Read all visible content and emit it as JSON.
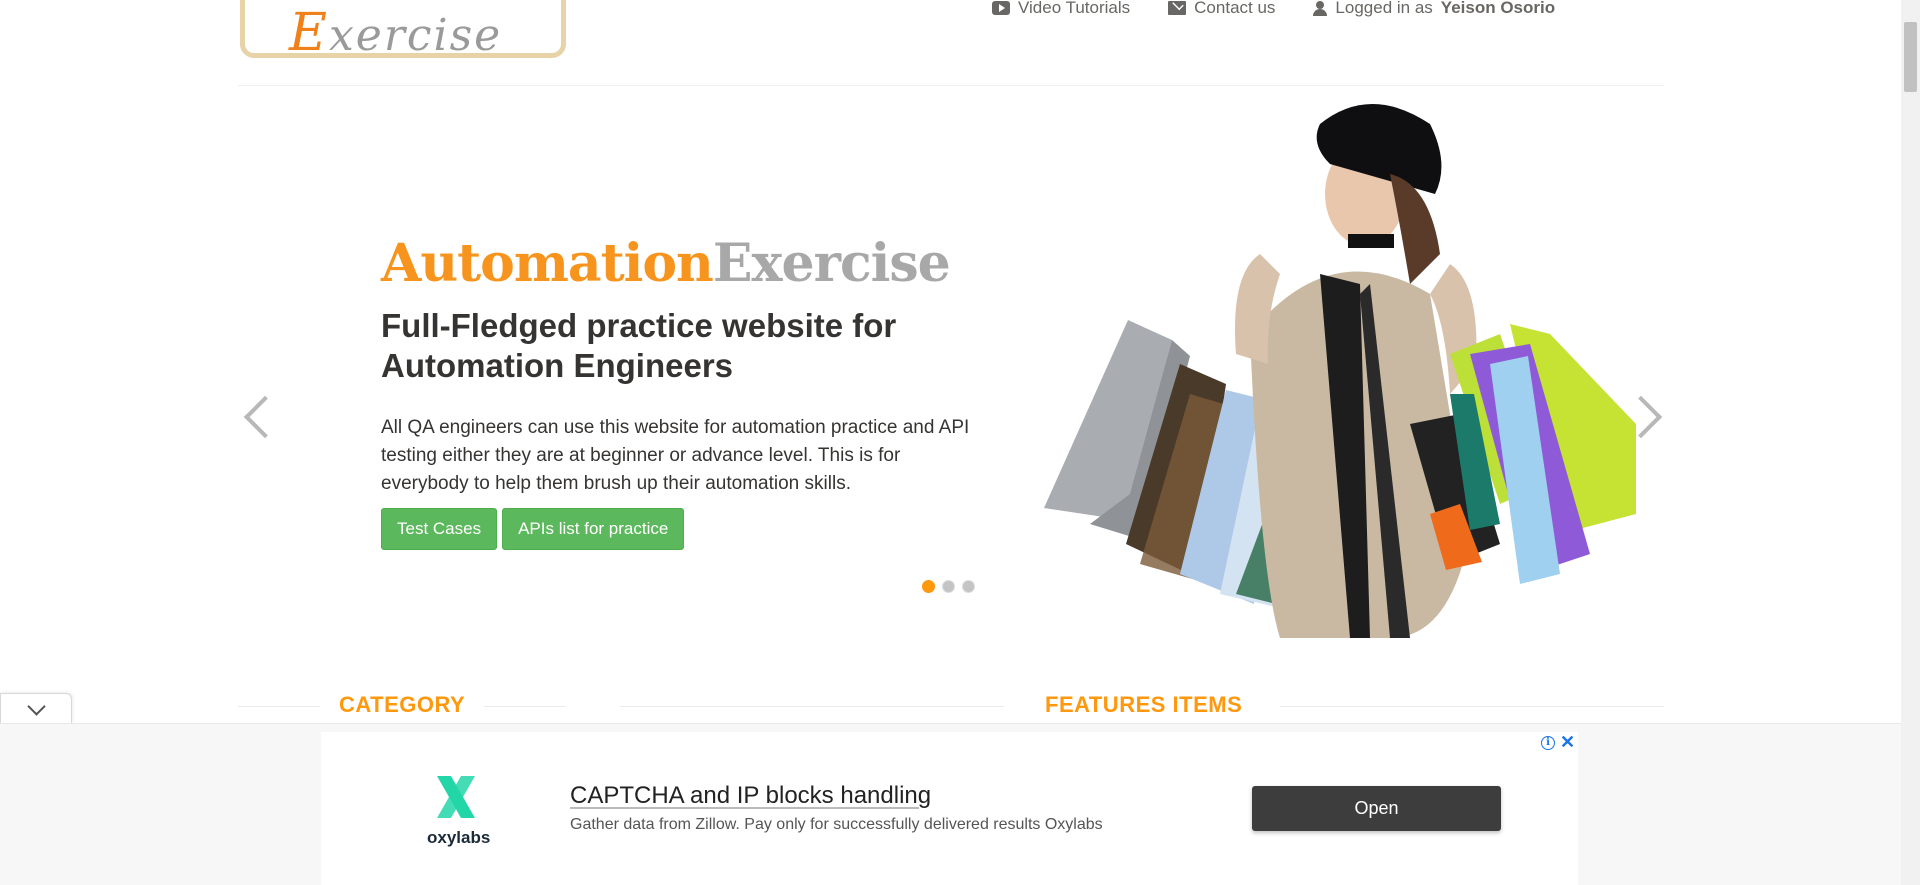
{
  "logo": {
    "text_first": "E",
    "text_rest": "xercise"
  },
  "nav": {
    "video_tutorials": "Video Tutorials",
    "contact_us": "Contact us",
    "logged_in_prefix": "Logged in as",
    "username": "Yeison Osorio"
  },
  "slider": {
    "brand_part1": "Automation",
    "brand_part2": "Exercise",
    "title_line1": "Full-Fledged practice website for",
    "title_line2": "Automation Engineers",
    "description": "All QA engineers can use this website for automation practice and API testing either they are at beginner or advance level. This is for everybody to help them brush up their automation skills.",
    "buttons": {
      "test_cases": "Test Cases",
      "apis_list": "APIs list for practice"
    },
    "active_slide": 1,
    "slide_count": 3
  },
  "sections": {
    "category": "CATEGORY",
    "features": "FEATURES ITEMS"
  },
  "ad": {
    "brand": "oxylabs",
    "title": "CAPTCHA and IP blocks handling",
    "subtitle": "Gather data from Zillow. Pay only for successfully delivered results Oxylabs",
    "open_label": "Open",
    "info_glyph": "i",
    "close_glyph": "✕"
  },
  "colors": {
    "accent_orange": "#fe980f",
    "button_green": "#5cb85c",
    "ad_button": "#3d3d3d",
    "ad_logo_teal": "#23d6a8"
  }
}
